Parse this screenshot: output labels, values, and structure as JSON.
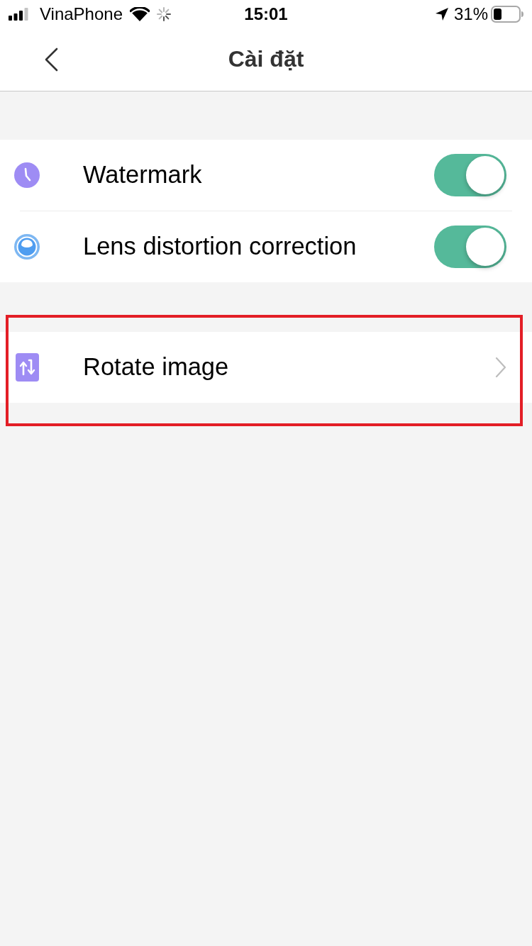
{
  "status_bar": {
    "carrier": "VinaPhone",
    "time": "15:01",
    "battery": "31%"
  },
  "nav": {
    "title": "Cài đặt"
  },
  "sections": [
    {
      "highlighted": false,
      "items": [
        {
          "kind": "toggle",
          "label": "Watermark",
          "on": true
        },
        {
          "kind": "toggle",
          "label": "Lens distortion correction",
          "on": true
        }
      ]
    },
    {
      "highlighted": true,
      "items": [
        {
          "kind": "link",
          "label": "Rotate image"
        }
      ]
    }
  ]
}
